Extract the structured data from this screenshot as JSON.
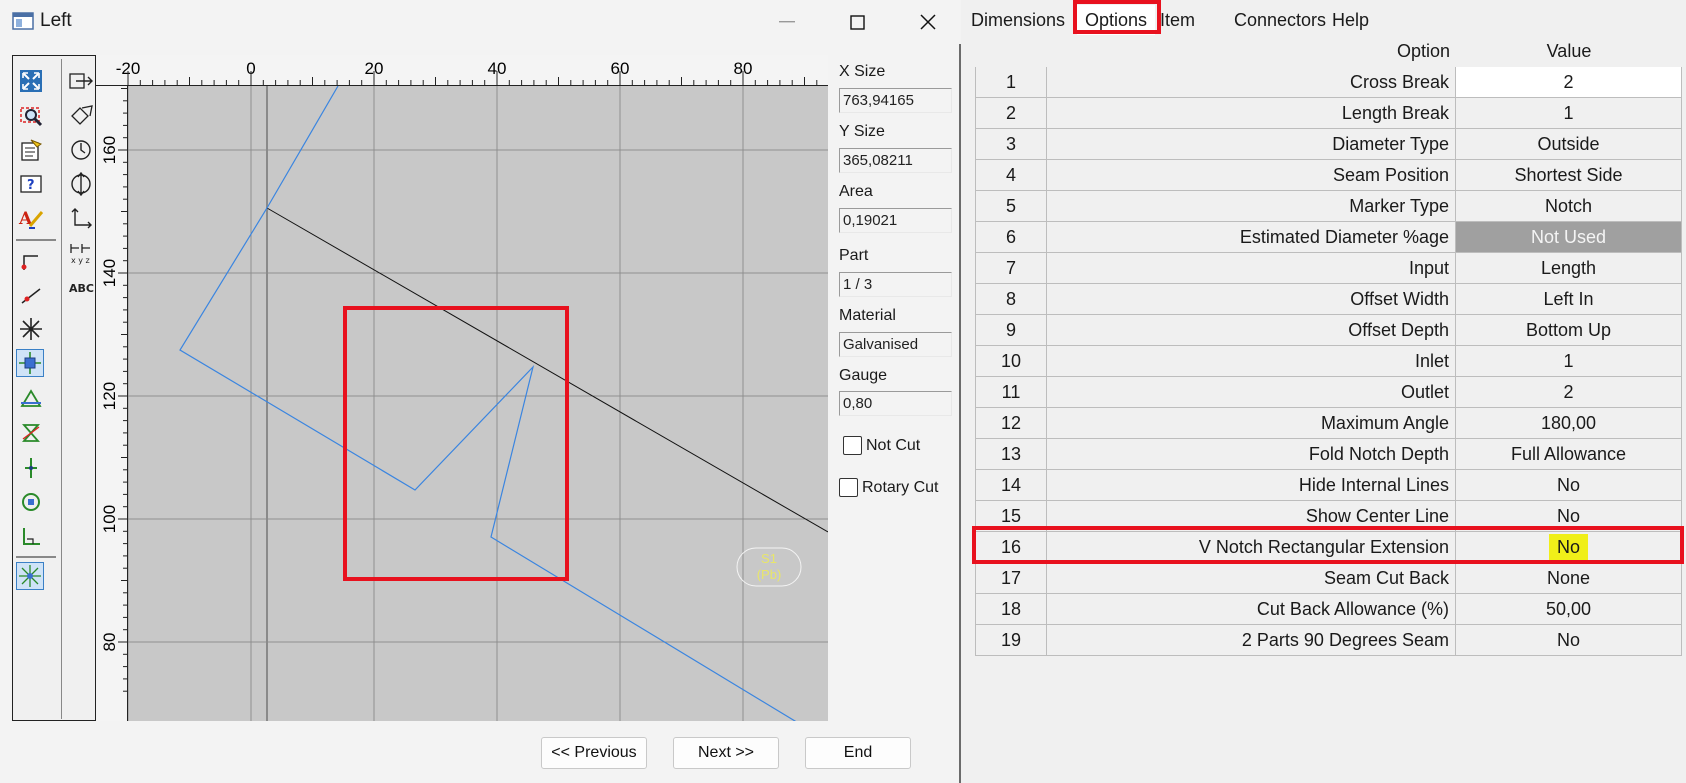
{
  "left_window": {
    "title": "Left",
    "controls": {
      "minimize": "—",
      "maximize": "☐",
      "close": "✕"
    },
    "ruler_x_labels": [
      "-20",
      "0",
      "20",
      "40",
      "60",
      "80"
    ],
    "ruler_y_labels": [
      "160",
      "140",
      "120",
      "100",
      "80"
    ],
    "toolbar_left": [
      "zoom-extents-icon",
      "zoom-window-icon",
      "properties-icon",
      "help-icon",
      "text-style-icon",
      "step-line-icon",
      "angle-line-icon",
      "asterisk-icon",
      "center-mark-icon",
      "triangle-icon",
      "hourglass-icon",
      "cross-icon",
      "target-icon",
      "corner-icon",
      "snap-icon"
    ],
    "toolbar_right": [
      "resize-icon",
      "rotate-icon",
      "clock-icon",
      "vertical-mirror-icon",
      "axis-icon",
      "dimension-xyz-icon",
      "abc-text-icon"
    ],
    "info": {
      "x_size_label": "X Size",
      "x_size": "763,94165",
      "y_size_label": "Y Size",
      "y_size": "365,08211",
      "area_label": "Area",
      "area": "0,19021",
      "part_label": "Part",
      "part": "1 / 3",
      "material_label": "Material",
      "material": "Galvanised",
      "gauge_label": "Gauge",
      "gauge": "0,80",
      "not_cut_label": "Not Cut",
      "rotary_cut_label": "Rotary Cut"
    },
    "seam_tag": {
      "line1": "S1",
      "line2": "(Pb)"
    },
    "buttons": {
      "previous": "<< Previous",
      "next": "Next >>",
      "end": "End"
    }
  },
  "right_window": {
    "tabs": [
      "Dimensions",
      "Options",
      "Item",
      "Connectors",
      "Help"
    ],
    "active_tab": "Options",
    "table": {
      "header_option": "Option",
      "header_value": "Value",
      "rows": [
        {
          "n": "1",
          "option": "Cross Break",
          "value": "2"
        },
        {
          "n": "2",
          "option": "Length Break",
          "value": "1"
        },
        {
          "n": "3",
          "option": "Diameter Type",
          "value": "Outside"
        },
        {
          "n": "4",
          "option": "Seam Position",
          "value": "Shortest Side"
        },
        {
          "n": "5",
          "option": "Marker Type",
          "value": "Notch"
        },
        {
          "n": "6",
          "option": "Estimated Diameter %age",
          "value": "Not Used"
        },
        {
          "n": "7",
          "option": "Input",
          "value": "Length"
        },
        {
          "n": "8",
          "option": "Offset Width",
          "value": "Left In"
        },
        {
          "n": "9",
          "option": "Offset Depth",
          "value": "Bottom Up"
        },
        {
          "n": "10",
          "option": "Inlet",
          "value": "1"
        },
        {
          "n": "11",
          "option": "Outlet",
          "value": "2"
        },
        {
          "n": "12",
          "option": "Maximum Angle",
          "value": "180,00"
        },
        {
          "n": "13",
          "option": "Fold Notch Depth",
          "value": "Full Allowance"
        },
        {
          "n": "14",
          "option": "Hide Internal Lines",
          "value": "No"
        },
        {
          "n": "15",
          "option": "Show Center Line",
          "value": "No"
        },
        {
          "n": "16",
          "option": "V Notch Rectangular Extension",
          "value": "No"
        },
        {
          "n": "17",
          "option": "Seam Cut Back",
          "value": "None"
        },
        {
          "n": "18",
          "option": "Cut Back Allowance (%)",
          "value": "50,00"
        },
        {
          "n": "19",
          "option": "2 Parts 90 Degrees Seam",
          "value": "No"
        }
      ]
    }
  },
  "colors": {
    "highlight": "#e8111e",
    "part_line": "#3a85e0",
    "value_highlight": "#f0ef19",
    "disabled_cell": "#a0a0a0"
  }
}
